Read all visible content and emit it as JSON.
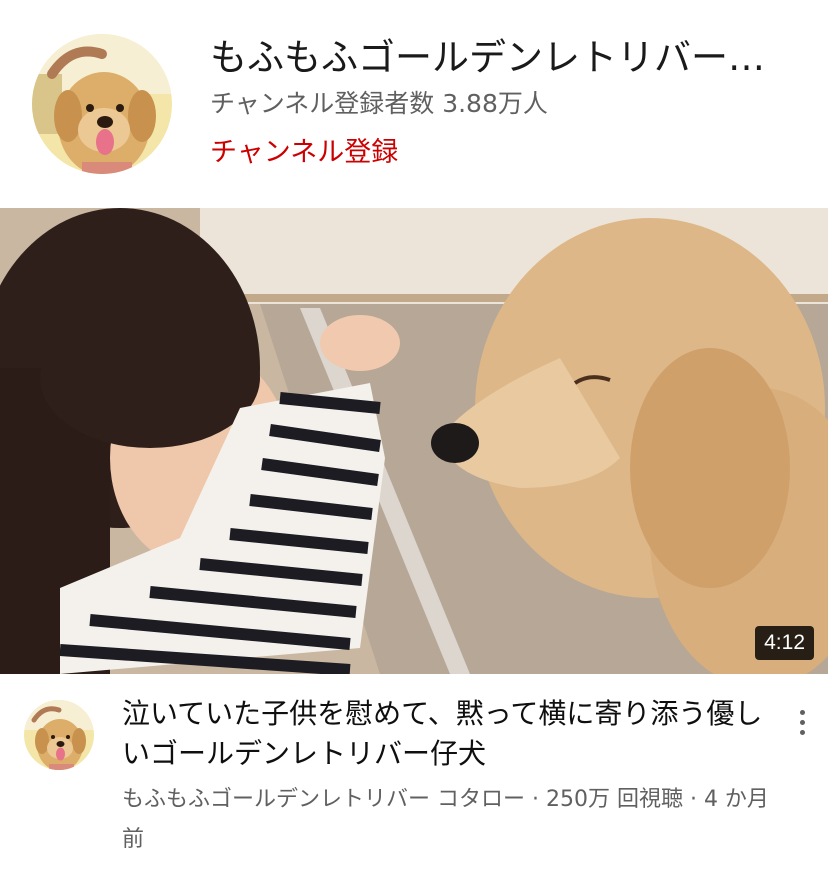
{
  "channel": {
    "name": "もふもふゴールデンレトリバー…",
    "subscribers": "チャンネル登録者数 3.88万人",
    "subscribe_label": "チャンネル登録",
    "avatar_icon": "golden-retriever-puppy-avatar"
  },
  "video": {
    "duration": "4:12",
    "title": "泣いていた子供を慰めて、黙って横に寄り添う優しいゴールデンレトリバー仔犬",
    "info": "もふもふゴールデンレトリバー コタロー · 250万 回視聴 · 4 か月前",
    "thumbnail_icon": "child-and-golden-retriever-thumbnail",
    "more_icon": "more-vert-icon"
  },
  "colors": {
    "subscribe": "#cc0000",
    "secondary_text": "#606060",
    "primary_text": "#0f0f0f",
    "badge_bg": "#000000"
  }
}
